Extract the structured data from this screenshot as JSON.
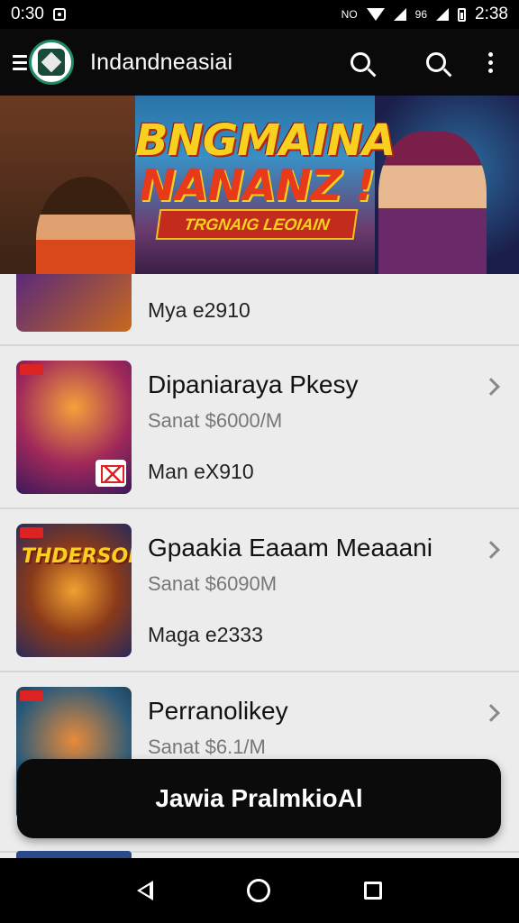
{
  "status_bar": {
    "time_left": "0:30",
    "signal_text": "NO",
    "network_text": "96",
    "time_right": "2:38"
  },
  "app_bar": {
    "title": "Indandneasiai",
    "icons": [
      "menu-icon",
      "app-logo",
      "search-icon",
      "search-icon",
      "more-vert-icon"
    ]
  },
  "banner": {
    "title_line1": "BNGMAINA",
    "title_line2": "NANANZ !",
    "ribbon": "TRGNAIG LEOIAIN"
  },
  "list": {
    "items": [
      {
        "title": "",
        "subtitle": "",
        "meta": "Mya e2910",
        "thumb_label": ""
      },
      {
        "title": "Dipaniaraya Pkesy",
        "subtitle": "Sanat $6000/M",
        "meta": "Man eX910",
        "thumb_label": ""
      },
      {
        "title": "Gpaakia Eaaam Meaaani",
        "subtitle": "Sanat $6090M",
        "meta": "Maga e2333",
        "thumb_label": "THDERSOI"
      },
      {
        "title": "Perranolikey",
        "subtitle": "Sanat $6.1/M",
        "meta": "",
        "thumb_label": ""
      }
    ]
  },
  "cta": {
    "label": "Jawia PralmkioAl"
  },
  "colors": {
    "status_bar": "#000000",
    "app_bar": "#0a0a0a",
    "list_background": "#ececec",
    "cta_background": "#0b0b0b",
    "subtitle_text": "#777777"
  }
}
